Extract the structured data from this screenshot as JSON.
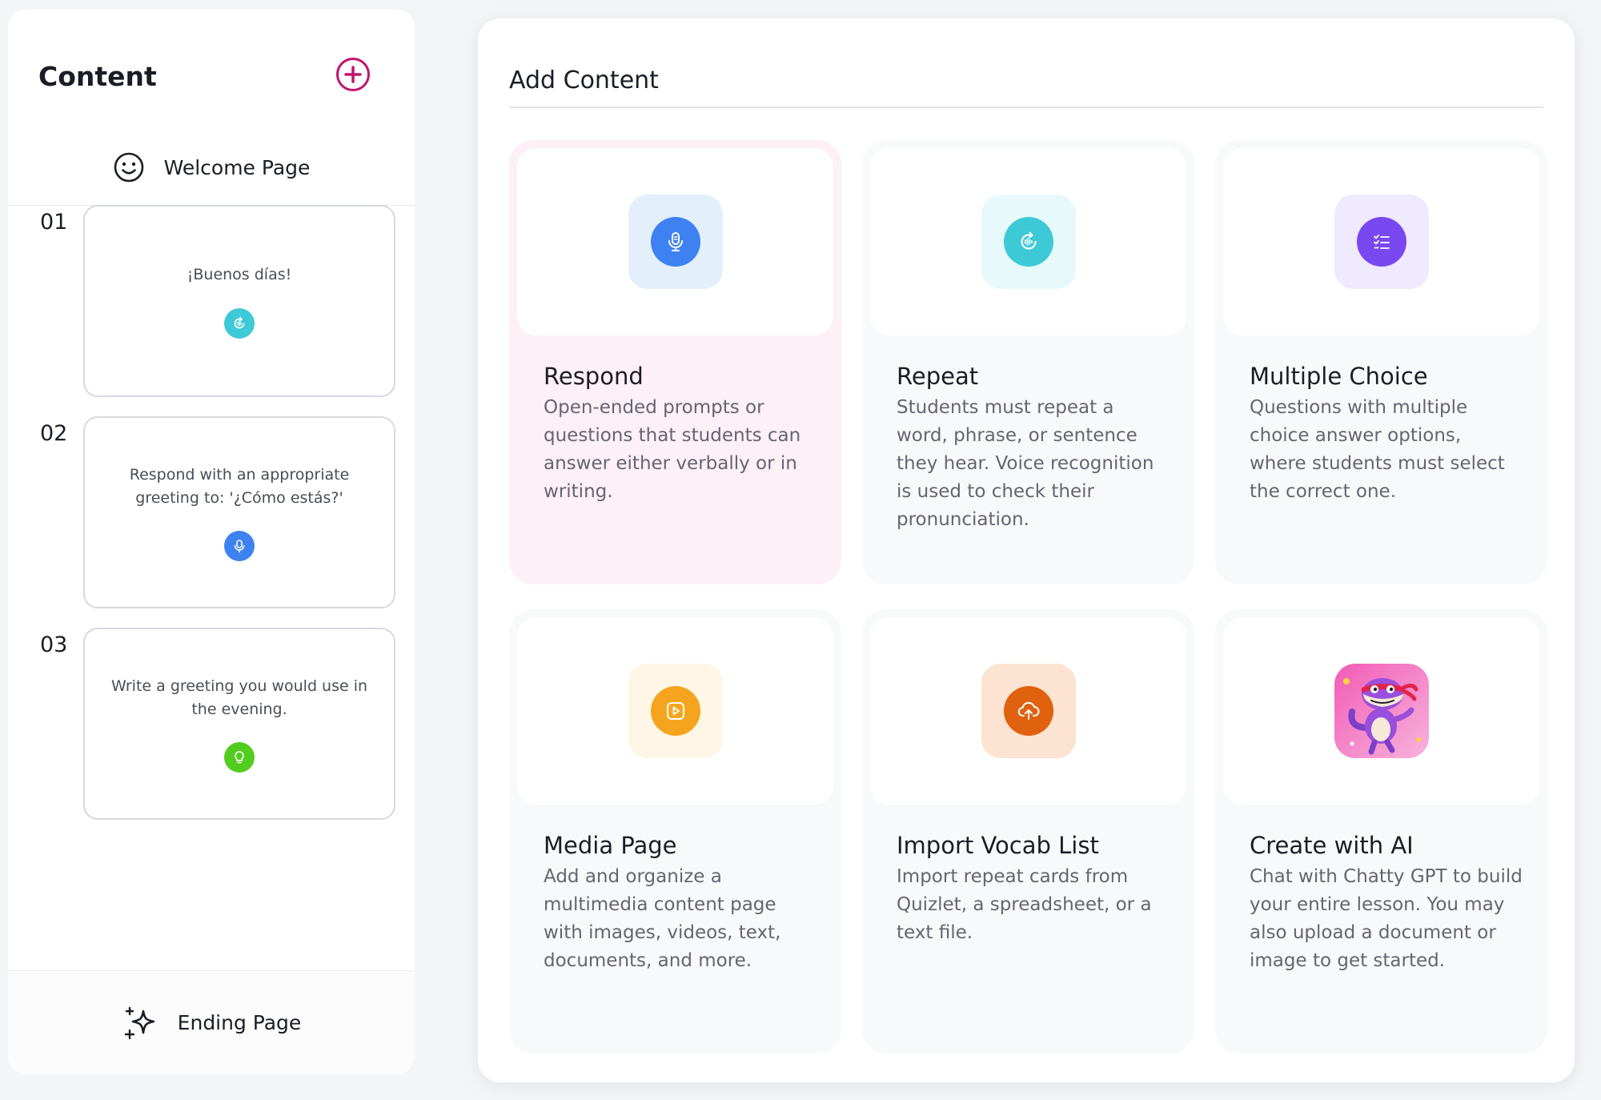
{
  "sidebar": {
    "title": "Content",
    "welcome_label": "Welcome Page",
    "ending_label": "Ending Page",
    "cards": [
      {
        "number": "01",
        "text": "¡Buenos días!",
        "type_icon": "repeat-icon",
        "color": "#3ec9d6"
      },
      {
        "number": "02",
        "text": "Respond with an appropriate greeting to: '¿Cómo estás?'",
        "type_icon": "respond-icon",
        "color": "#3d82f0"
      },
      {
        "number": "03",
        "text": "Write a greeting you would use in the evening.",
        "type_icon": "lightbulb-icon",
        "color": "#52cc1e"
      }
    ]
  },
  "main": {
    "title": "Add Content",
    "tiles": [
      {
        "title": "Respond",
        "description": "Open-ended prompts or questions that students can answer either verbally or in writing.",
        "icon": "microphone-icon",
        "accent": "#3d82f0",
        "icon_bg": "#e4effc",
        "active": true
      },
      {
        "title": "Repeat",
        "description": "Students must repeat a word, phrase, or sentence they hear. Voice recognition is used to check their pronunciation.",
        "icon": "repeat-audio-icon",
        "accent": "#3ec9d6",
        "icon_bg": "#e8f9fb"
      },
      {
        "title": "Multiple Choice",
        "description": "Questions with multiple choice answer options, where students must select the correct one.",
        "icon": "checklist-icon",
        "accent": "#7a48f0",
        "icon_bg": "#efeafd"
      },
      {
        "title": "Media Page",
        "description": "Add and organize a multimedia content page with images, videos, text, documents, and more.",
        "icon": "play-icon",
        "accent": "#f5a51d",
        "icon_bg": "#fff6e5"
      },
      {
        "title": "Import Vocab List",
        "description": "Import repeat cards from Quizlet, a spreadsheet, or a text file.",
        "icon": "cloud-upload-icon",
        "accent": "#e0610e",
        "icon_bg": "#fde3d2"
      },
      {
        "title": "Create with AI",
        "description": "Chat with Chatty GPT to build your entire lesson. You may also upload a document or image to get started.",
        "icon": "mascot-icon",
        "accent": "#e43d9a",
        "icon_bg": "#f7c6e3"
      }
    ]
  },
  "colors": {
    "brand_plus": "#c4136d",
    "active_tile_bg": "#fdf0f6"
  }
}
